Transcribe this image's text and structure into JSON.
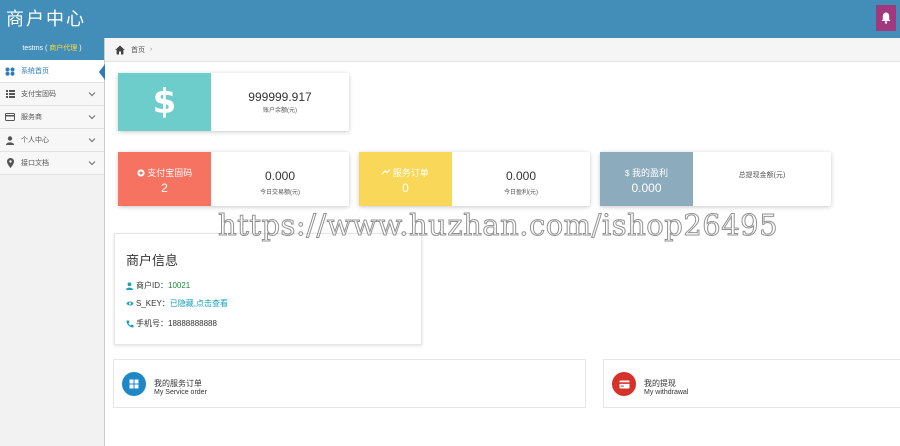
{
  "app": {
    "title": "商户中心"
  },
  "sidebar": {
    "user": {
      "name": "testms",
      "open_paren": " ( ",
      "badge": "商户代理",
      "close_paren": " )"
    },
    "items": [
      {
        "label": "系统首页",
        "icon": "dashboard-icon",
        "active": true
      },
      {
        "label": "支付宝固码",
        "icon": "list-icon",
        "expandable": true
      },
      {
        "label": "服务商",
        "icon": "credit-card-icon",
        "expandable": true
      },
      {
        "label": "个人中心",
        "icon": "user-icon",
        "expandable": true
      },
      {
        "label": "接口文档",
        "icon": "map-marker-icon",
        "expandable": true
      }
    ]
  },
  "breadcrumb": {
    "home": "首页",
    "separator": "›"
  },
  "balance": {
    "symbol": "$",
    "value": "999999.917",
    "label": "账户余额(元)"
  },
  "stats": [
    {
      "icon": "alipay-icon",
      "title": "支付宝固码",
      "count": "2",
      "value": "0.000",
      "label": "今日交易额(元)",
      "color": "#f57360"
    },
    {
      "icon": "chart-icon",
      "title": "服务订单",
      "count": "0",
      "value": "0.000",
      "label": "今日盈利(元)",
      "color": "#f9d859"
    },
    {
      "icon": "dollar-icon",
      "title": "我的盈利",
      "count": "0.000",
      "value": "",
      "label": "总提现金额(元)",
      "color": "#8cacbd"
    }
  ],
  "merchant": {
    "title": "商户信息",
    "id_label": "商户ID：",
    "id_value": "10021",
    "skey_label": "S_KEY：",
    "skey_value": "已隐藏,点击查看",
    "phone_label": "手机号：",
    "phone_value": "18888888888"
  },
  "bottom": [
    {
      "title": "我的服务订单",
      "subtitle": "My Service order",
      "color": "#1e88c7",
      "icon": "grid-icon"
    },
    {
      "title": "我的提现",
      "subtitle": "My withdrawal",
      "color": "#d6322c",
      "icon": "card-icon"
    }
  ],
  "watermark": "https://www.huzhan.com/ishop26495",
  "colors": {
    "header": "#438eb9",
    "bell": "#a2397f",
    "balance": "#6dcdca"
  }
}
